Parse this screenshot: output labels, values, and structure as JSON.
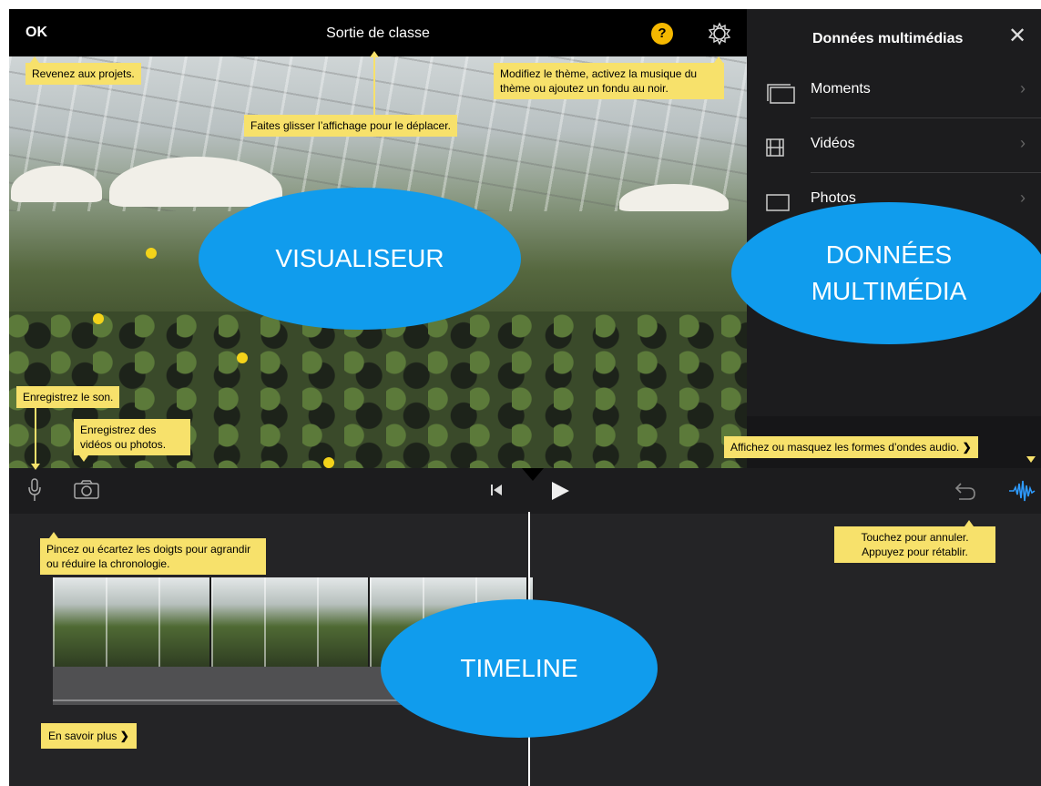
{
  "topbar": {
    "ok_label": "OK",
    "project_title": "Sortie de classe",
    "help_label": "?"
  },
  "media_panel": {
    "title": "Données multimédias",
    "close_label": "✕",
    "items": [
      {
        "label": "Moments",
        "icon": "moments-icon"
      },
      {
        "label": "Vidéos",
        "icon": "film-icon"
      },
      {
        "label": "Photos",
        "icon": "photo-icon"
      }
    ]
  },
  "tips": {
    "projects": "Revenez aux projets.",
    "drag": "Faites glisser l’affichage pour le déplacer.",
    "theme": "Modifiez le thème, activez la musique du thème ou ajoutez un fondu au noir.",
    "sound": "Enregistrez le son.",
    "video": "Enregistrez des vidéos ou photos.",
    "waveforms": "Affichez ou masquez les formes d’ondes audio.",
    "pinch": "Pincez ou écartez les doigts pour agrandir ou réduire la chronologie.",
    "undo": "Touchez pour annuler. Appuyez pour rétablir.",
    "learn_more": "En savoir plus"
  },
  "callouts": {
    "viewer": "VISUALISEUR",
    "media": "DONNÉES MULTIMÉDIA",
    "timeline": "TIMELINE"
  },
  "colors": {
    "tooltip": "#f7e16b",
    "callout": "#109ced",
    "help": "#f5b800",
    "waveform_toggle": "#2e9bff"
  }
}
